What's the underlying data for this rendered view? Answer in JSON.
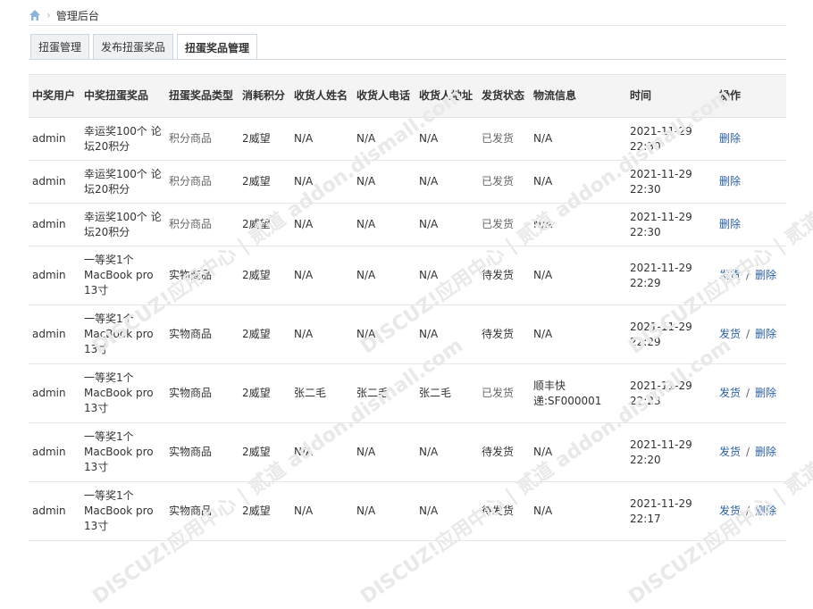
{
  "breadcrumb": {
    "icon": "home-icon",
    "title": "管理后台"
  },
  "tabs": [
    {
      "label": "扭蛋管理",
      "active": false
    },
    {
      "label": "发布扭蛋奖品",
      "active": false
    },
    {
      "label": "扭蛋奖品管理",
      "active": true
    }
  ],
  "table": {
    "headers": [
      "中奖用户",
      "中奖扭蛋奖品",
      "扭蛋奖品类型",
      "消耗积分",
      "收货人姓名",
      "收货人电话",
      "收货人地址",
      "发货状态",
      "物流信息",
      "时间",
      "操作"
    ],
    "rows": [
      {
        "user": "admin",
        "prize": "幸运奖100个 论坛20积分",
        "type": "积分商品",
        "cost": "2威望",
        "name": "N/A",
        "phone": "N/A",
        "address": "N/A",
        "status": "已发货",
        "logistics": "N/A",
        "time": "2021-11-29 22:30",
        "ship": "",
        "delete": "删除"
      },
      {
        "user": "admin",
        "prize": "幸运奖100个 论坛20积分",
        "type": "积分商品",
        "cost": "2威望",
        "name": "N/A",
        "phone": "N/A",
        "address": "N/A",
        "status": "已发货",
        "logistics": "N/A",
        "time": "2021-11-29 22:30",
        "ship": "",
        "delete": "删除"
      },
      {
        "user": "admin",
        "prize": "幸运奖100个 论坛20积分",
        "type": "积分商品",
        "cost": "2威望",
        "name": "N/A",
        "phone": "N/A",
        "address": "N/A",
        "status": "已发货",
        "logistics": "N/A",
        "time": "2021-11-29 22:30",
        "ship": "",
        "delete": "删除"
      },
      {
        "user": "admin",
        "prize": "一等奖1个 MacBook pro 13寸",
        "type": "实物商品",
        "cost": "2威望",
        "name": "N/A",
        "phone": "N/A",
        "address": "N/A",
        "status": "待发货",
        "logistics": "N/A",
        "time": "2021-11-29 22:29",
        "ship": "发货",
        "delete": "删除"
      },
      {
        "user": "admin",
        "prize": "一等奖1个 MacBook pro 13寸",
        "type": "实物商品",
        "cost": "2威望",
        "name": "N/A",
        "phone": "N/A",
        "address": "N/A",
        "status": "待发货",
        "logistics": "N/A",
        "time": "2021-11-29 22:29",
        "ship": "发货",
        "delete": "删除"
      },
      {
        "user": "admin",
        "prize": "一等奖1个 MacBook pro 13寸",
        "type": "实物商品",
        "cost": "2威望",
        "name": "张二毛",
        "phone": "张二毛",
        "address": "张二毛",
        "status": "已发货",
        "logistics": "顺丰快递:SF000001",
        "time": "2021-11-29 22:23",
        "ship": "发货",
        "delete": "删除"
      },
      {
        "user": "admin",
        "prize": "一等奖1个 MacBook pro 13寸",
        "type": "实物商品",
        "cost": "2威望",
        "name": "N/A",
        "phone": "N/A",
        "address": "N/A",
        "status": "待发货",
        "logistics": "N/A",
        "time": "2021-11-29 22:20",
        "ship": "发货",
        "delete": "删除"
      },
      {
        "user": "admin",
        "prize": "一等奖1个 MacBook pro 13寸",
        "type": "实物商品",
        "cost": "2威望",
        "name": "N/A",
        "phone": "N/A",
        "address": "N/A",
        "status": "待发货",
        "logistics": "N/A",
        "time": "2021-11-29 22:17",
        "ship": "发货",
        "delete": "删除"
      }
    ]
  },
  "colors": {
    "link": "#2b5f9e",
    "header_bg": "#f4f4f4",
    "tab_bg": "#eef2f5"
  },
  "watermark": "DISCUZ!应用中心 | 贰道 addon.dismall.com"
}
